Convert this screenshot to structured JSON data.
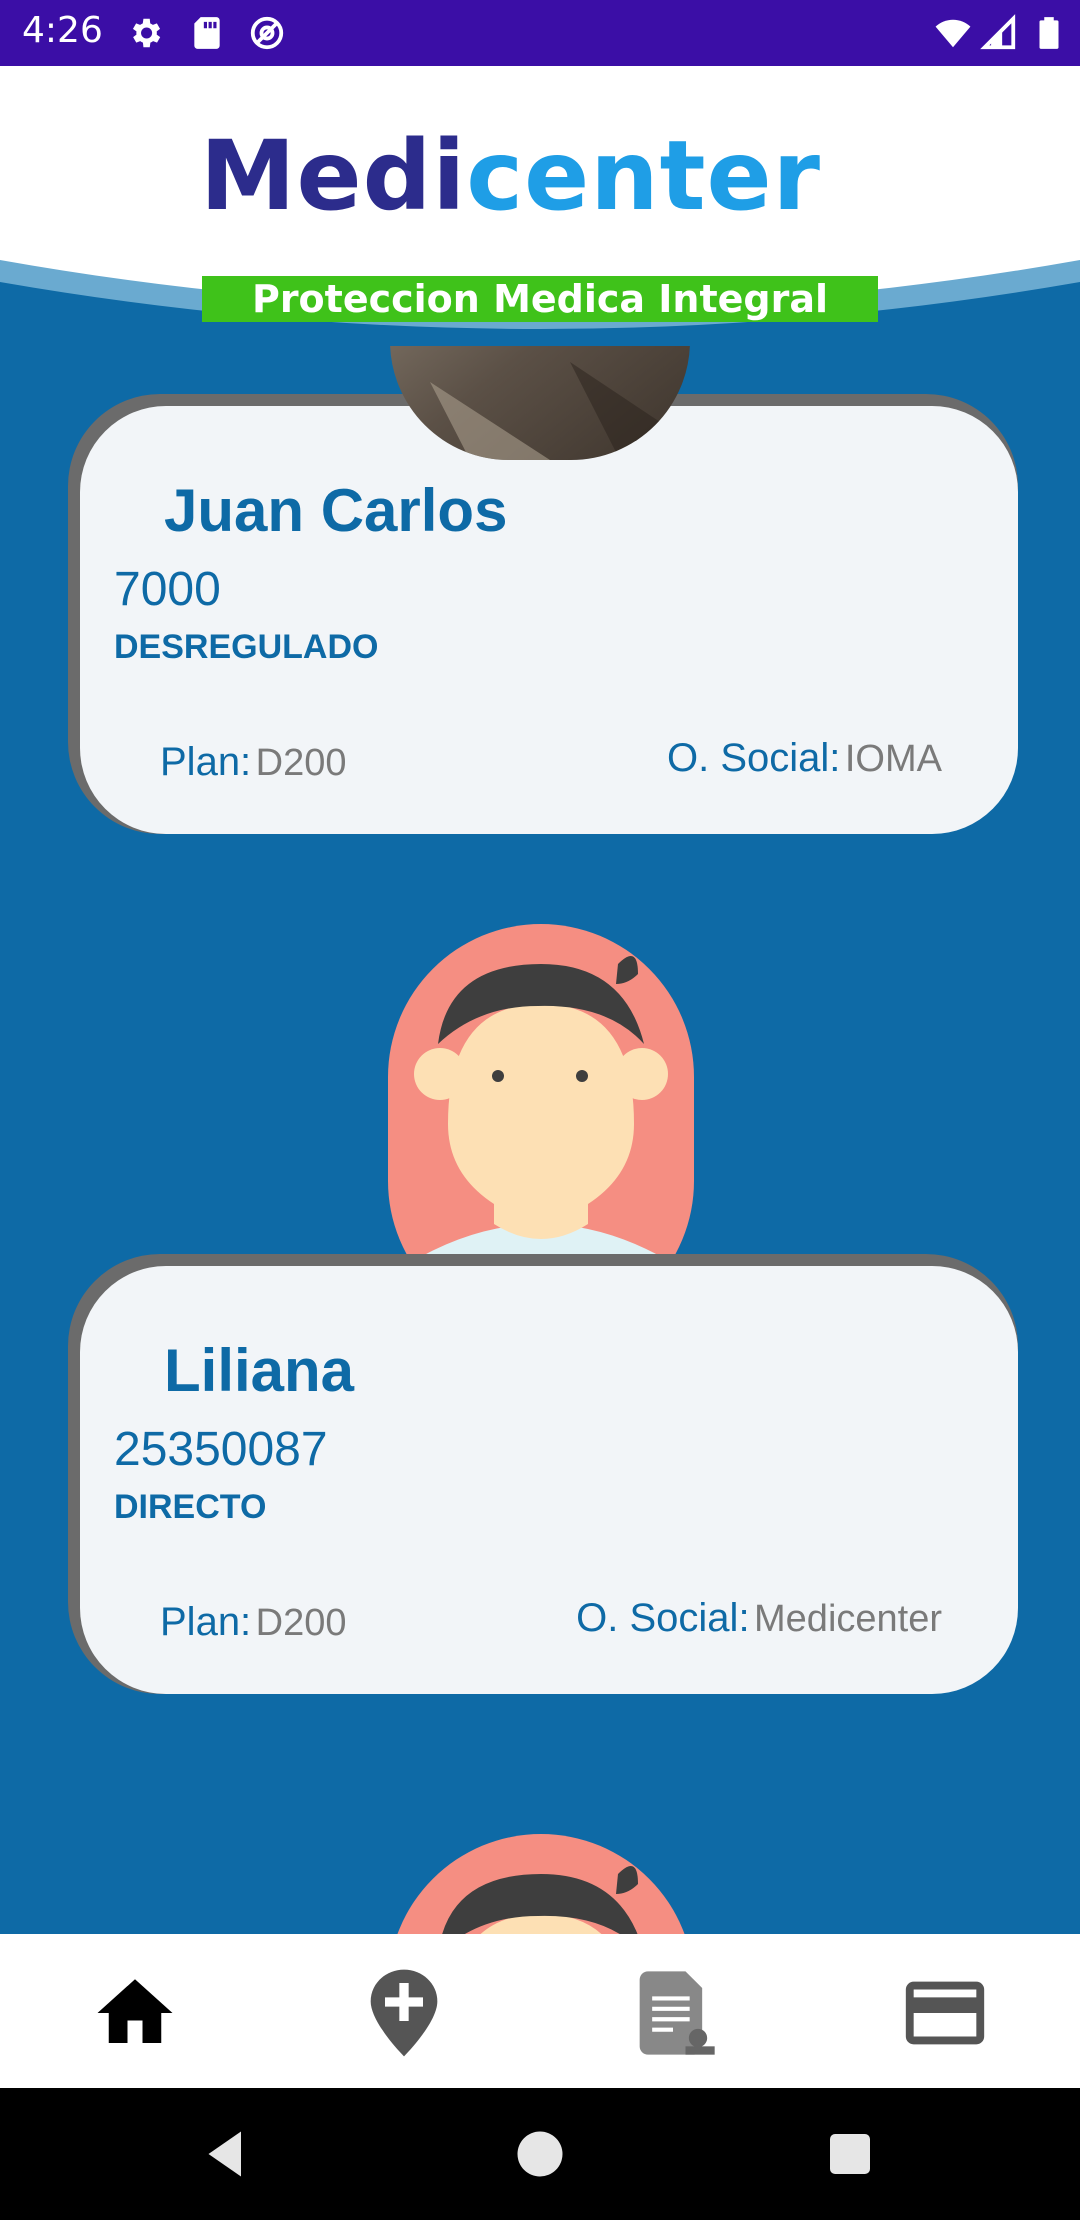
{
  "status_bar": {
    "time": "4:26",
    "left_icons": [
      "settings-icon",
      "sd-card-icon",
      "vpn-icon"
    ],
    "right_icons": [
      "wifi-icon",
      "signal-icon",
      "battery-icon"
    ],
    "background": "#3b0ea6"
  },
  "header": {
    "logo_part1": "Medi",
    "logo_part2": "center",
    "tagline": "Proteccion Medica Integral",
    "colors": {
      "medi": "#2c2c8c",
      "center": "#1f9ee6",
      "tagline_bg": "#3fc21a"
    }
  },
  "members": [
    {
      "name": "Juan Carlos",
      "id": "7000",
      "type": "DESREGULADO",
      "plan_label": "Plan:",
      "plan_value": "D200",
      "social_label": "O. Social:",
      "social_value": "IOMA"
    },
    {
      "name": "Liliana",
      "id": "25350087",
      "type": "DIRECTO",
      "plan_label": "Plan:",
      "plan_value": "D200",
      "social_label": "O. Social:",
      "social_value": "Medicenter"
    }
  ],
  "bottom_nav": {
    "items": [
      "home-icon",
      "location-add-icon",
      "document-icon",
      "credit-card-icon"
    ],
    "active": "home-icon"
  },
  "system_nav": [
    "back-icon",
    "home-circle-icon",
    "recents-icon"
  ],
  "colors": {
    "background": "#0e6aa6",
    "card": "#f2f5f8",
    "card_border": "#6b6b6b",
    "primary_text": "#0e6aa6",
    "value_text": "#7a7a7a",
    "avatar_bg": "#f58e82"
  }
}
